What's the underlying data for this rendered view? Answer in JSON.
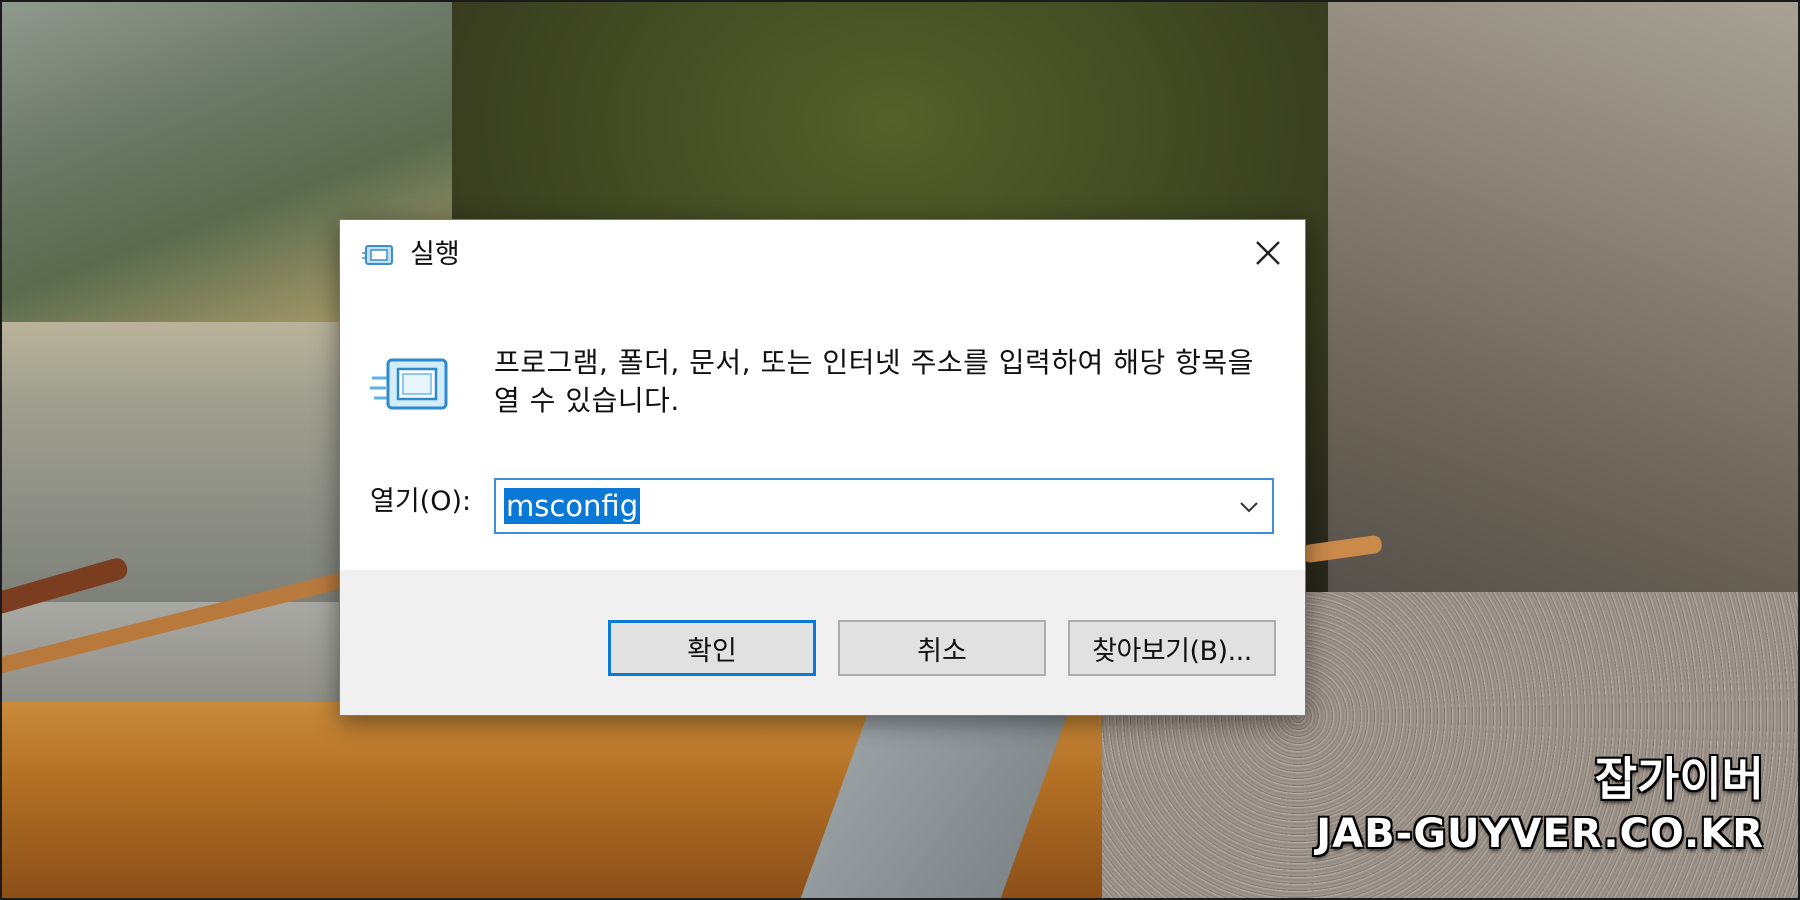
{
  "dialog": {
    "title": "실행",
    "description": "프로그램, 폴더, 문서, 또는 인터넷 주소를 입력하여 해당 항목을 열 수 있습니다.",
    "open_label": "열기(O):",
    "open_value": "msconfig",
    "buttons": {
      "ok": "확인",
      "cancel": "취소",
      "browse": "찾아보기(B)..."
    },
    "accent_color": "#0a78d7",
    "focus_border_color": "#3c8fd8"
  },
  "watermark": {
    "korean": "잡가이버",
    "domain": "JAB-GUYVER.CO.KR"
  }
}
